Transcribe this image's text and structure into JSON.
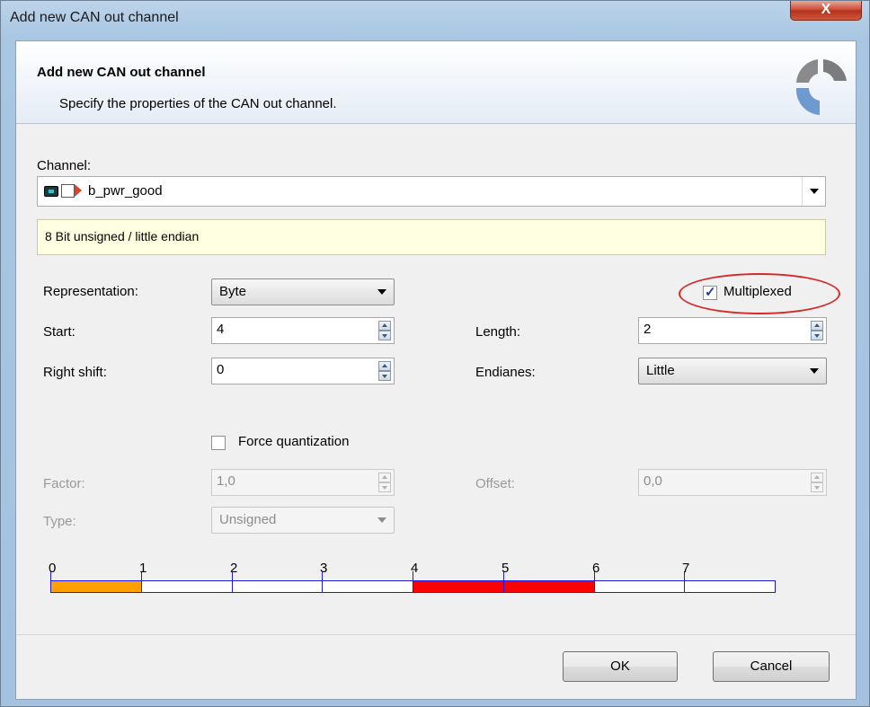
{
  "window": {
    "title": "Add new CAN out channel",
    "close_glyph": "X"
  },
  "header": {
    "title": "Add new CAN out channel",
    "subtitle": "Specify the properties of the CAN out channel."
  },
  "channel": {
    "label": "Channel:",
    "value": "b_pwr_good",
    "icons": [
      "device-icon",
      "signal-icon",
      "output-arrow-icon"
    ],
    "info": "8 Bit unsigned / little endian"
  },
  "form": {
    "representation_label": "Representation:",
    "representation_value": "Byte",
    "multiplexed_label": "Multiplexed",
    "multiplexed_checked": true,
    "start_label": "Start:",
    "start_value": "4",
    "length_label": "Length:",
    "length_value": "2",
    "right_shift_label": "Right shift:",
    "right_shift_value": "0",
    "endianes_label": "Endianes:",
    "endianes_value": "Little",
    "force_quantization_label": "Force quantization",
    "force_quantization_checked": false,
    "factor_label": "Factor:",
    "factor_value": "1,0",
    "offset_label": "Offset:",
    "offset_value": "0,0",
    "type_label": "Type:",
    "type_value": "Unsigned"
  },
  "bit_layout": {
    "labels": [
      "0",
      "1",
      "2",
      "3",
      "4",
      "5",
      "6",
      "7"
    ],
    "cells": [
      {
        "state": "multiplexer"
      },
      {
        "state": "free"
      },
      {
        "state": "free"
      },
      {
        "state": "free"
      },
      {
        "state": "signal"
      },
      {
        "state": "signal"
      },
      {
        "state": "free"
      },
      {
        "state": "free"
      }
    ],
    "colors": {
      "multiplexer": "#ff9f00",
      "signal": "#ff0000",
      "free": "#ffffff",
      "border": "#1a1ae0"
    }
  },
  "buttons": {
    "ok": "OK",
    "cancel": "Cancel"
  }
}
